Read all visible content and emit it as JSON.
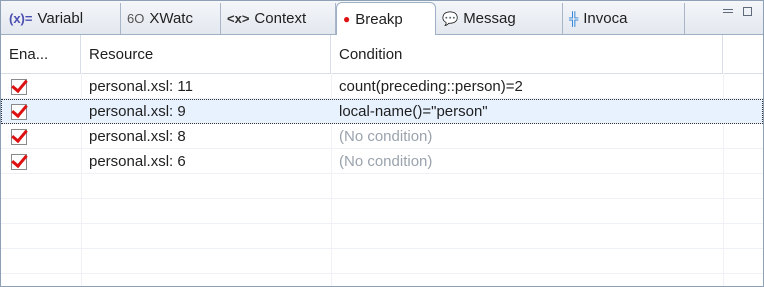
{
  "tabs": [
    {
      "label": "Variabl",
      "icon": "variables-icon",
      "glyph": "(x)="
    },
    {
      "label": "XWatc",
      "icon": "glasses-icon",
      "glyph": "6O"
    },
    {
      "label": "Context",
      "icon": "angle-brackets-icon",
      "glyph": "<x>"
    },
    {
      "label": "Breakp",
      "icon": "breakpoints-icon",
      "glyph": "●"
    },
    {
      "label": "Messag",
      "icon": "speech-bubble-icon",
      "glyph": "💬"
    },
    {
      "label": "Invoca",
      "icon": "tree-invocations-icon",
      "glyph": "╬"
    }
  ],
  "table": {
    "headers": [
      "Ena...",
      "Resource",
      "Condition"
    ],
    "rows": [
      {
        "resource": "personal.xsl: 11",
        "condition": "count(preceding::person)=2",
        "enabled": true
      },
      {
        "resource": "personal.xsl: 9",
        "condition": "local-name()=\"person\"",
        "enabled": true
      },
      {
        "resource": "personal.xsl: 8",
        "condition": "(No condition)",
        "enabled": true
      },
      {
        "resource": "personal.xsl: 6",
        "condition": "(No condition)",
        "enabled": true
      }
    ]
  },
  "colors": {
    "accent_check": "#dd1111",
    "selected_row": "#e8f2ff"
  }
}
